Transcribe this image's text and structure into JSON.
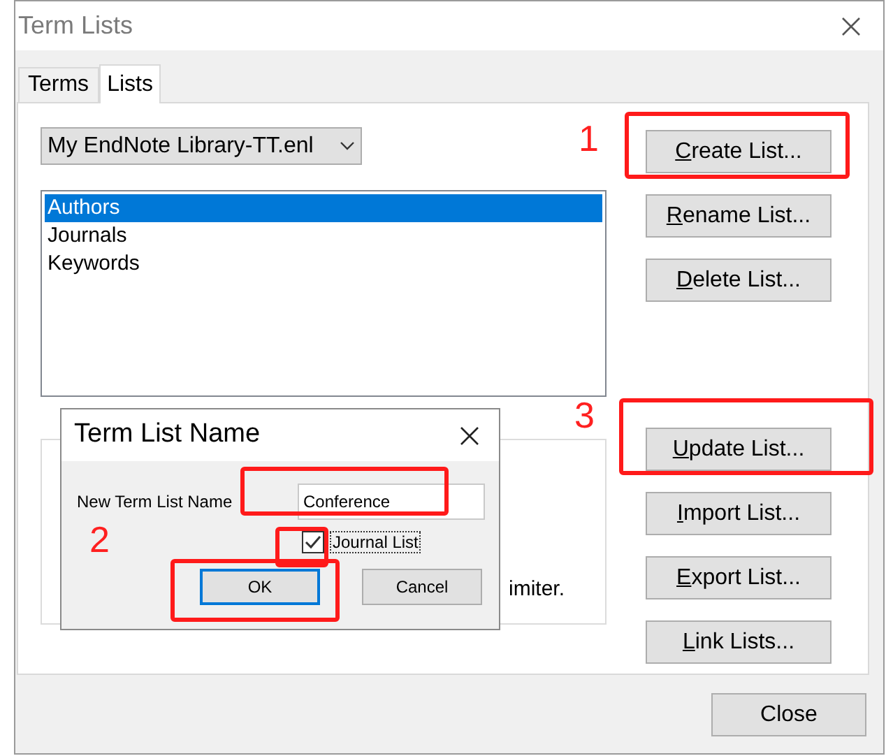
{
  "window": {
    "title": "Term Lists"
  },
  "tabs": [
    {
      "label": "Terms",
      "selected": false
    },
    {
      "label": "Lists",
      "selected": true
    }
  ],
  "library_dropdown": {
    "value": "My EndNote Library-TT.enl"
  },
  "lists": [
    {
      "label": "Authors",
      "selected": true
    },
    {
      "label": "Journals",
      "selected": false
    },
    {
      "label": "Keywords",
      "selected": false
    }
  ],
  "group_box": {
    "text": "imiter."
  },
  "button_groups": [
    [
      {
        "label": "Create List...",
        "mnemonic": true
      },
      {
        "label": "Rename List...",
        "mnemonic": true
      },
      {
        "label": "Delete List...",
        "mnemonic": true
      }
    ],
    [
      {
        "label": "Update List...",
        "mnemonic": true
      },
      {
        "label": "Import List...",
        "mnemonic": true
      },
      {
        "label": "Export List...",
        "mnemonic": true
      },
      {
        "label": "Link Lists...",
        "mnemonic": true
      }
    ]
  ],
  "close_button": {
    "label": "Close"
  },
  "dialog": {
    "title": "Term List Name",
    "field_label": "New Term List Name",
    "field_value": "Conference",
    "checkbox": {
      "label": "Journal List",
      "checked": true
    },
    "buttons": [
      {
        "label": "OK",
        "default": true
      },
      {
        "label": "Cancel",
        "default": false
      }
    ]
  },
  "annotations": [
    {
      "label": "1"
    },
    {
      "label": "2"
    },
    {
      "label": "3"
    }
  ]
}
